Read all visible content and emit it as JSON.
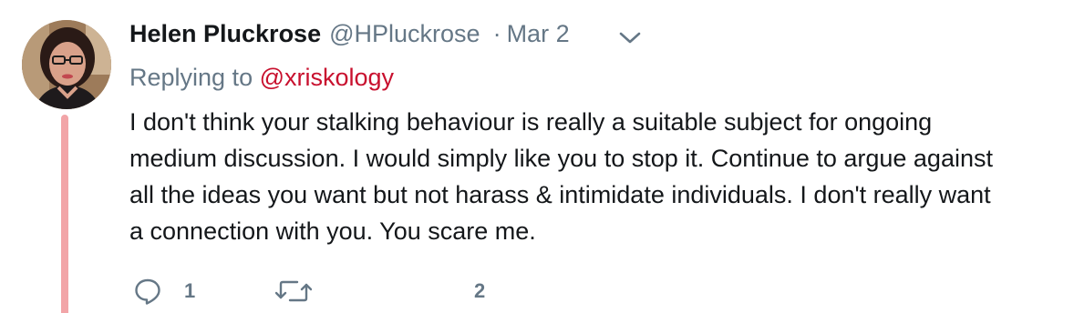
{
  "tweet": {
    "display_name": "Helen Pluckrose",
    "handle": "@HPluckrose",
    "separator": "·",
    "date": "Mar 2",
    "replying_label": "Replying to",
    "replying_handle": "@xriskology",
    "body_lines": [
      "I don't think your stalking behaviour is really a suitable subject for ongoing",
      "medium discussion. I would simply like you to stop it. Continue to argue against",
      "all the ideas you want but not harass & intimidate individuals. I don't really want",
      "a connection with you. You scare me."
    ],
    "actions": {
      "reply_count": "1",
      "retweet_count": "",
      "like_count": "2"
    }
  },
  "icons": {
    "caret": "chevron-down-icon",
    "reply": "reply-icon",
    "retweet": "retweet-icon"
  },
  "colors": {
    "name": "#14171a",
    "secondary": "#657786",
    "mention": "#c8102e",
    "thread_line": "#f2a5a8"
  }
}
